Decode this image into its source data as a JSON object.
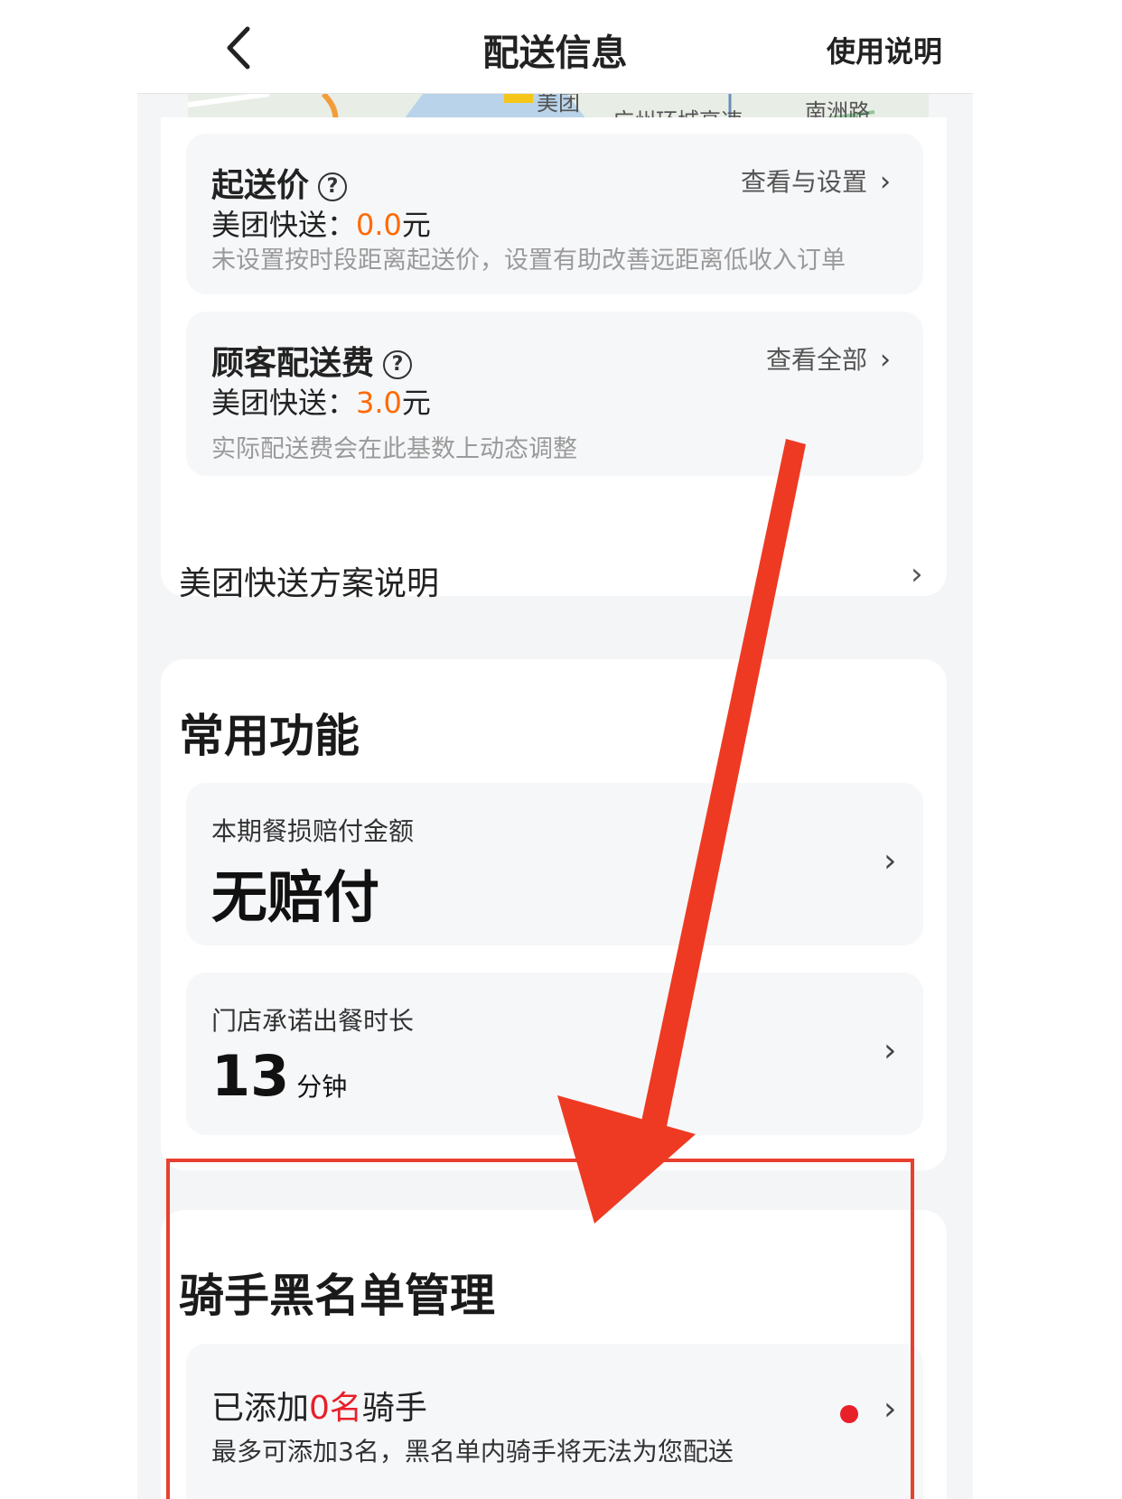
{
  "header": {
    "title": "配送信息",
    "help_label": "使用说明"
  },
  "map": {
    "labels": [
      "美团",
      "广州环城高速",
      "南洲路"
    ]
  },
  "min_order": {
    "title": "起送价",
    "link_label": "查看与设置",
    "service_label": "美团快送：",
    "amount": "0.0",
    "currency": "元",
    "hint": "未设置按时段距离起送价，设置有助改善远距离低收入订单"
  },
  "delivery_fee": {
    "title": "顾客配送费",
    "link_label": "查看全部",
    "service_label": "美团快送：",
    "amount": "3.0",
    "currency": "元",
    "hint": "实际配送费会在此基数上动态调整"
  },
  "plan": {
    "label": "美团快送方案说明"
  },
  "common": {
    "title": "常用功能",
    "compensation": {
      "label": "本期餐损赔付金额",
      "value": "无赔付"
    },
    "prep_time": {
      "label": "门店承诺出餐时长",
      "value": "13",
      "unit": "分钟"
    }
  },
  "blacklist": {
    "title": "骑手黑名单管理",
    "prefix": "已添加",
    "count": "0名",
    "suffix": "骑手",
    "hint": "最多可添加3名，黑名单内骑手将无法为您配送"
  },
  "colors": {
    "accent_orange": "#ff6a00",
    "accent_red": "#e8202a",
    "annotation_red": "#e8402e"
  }
}
